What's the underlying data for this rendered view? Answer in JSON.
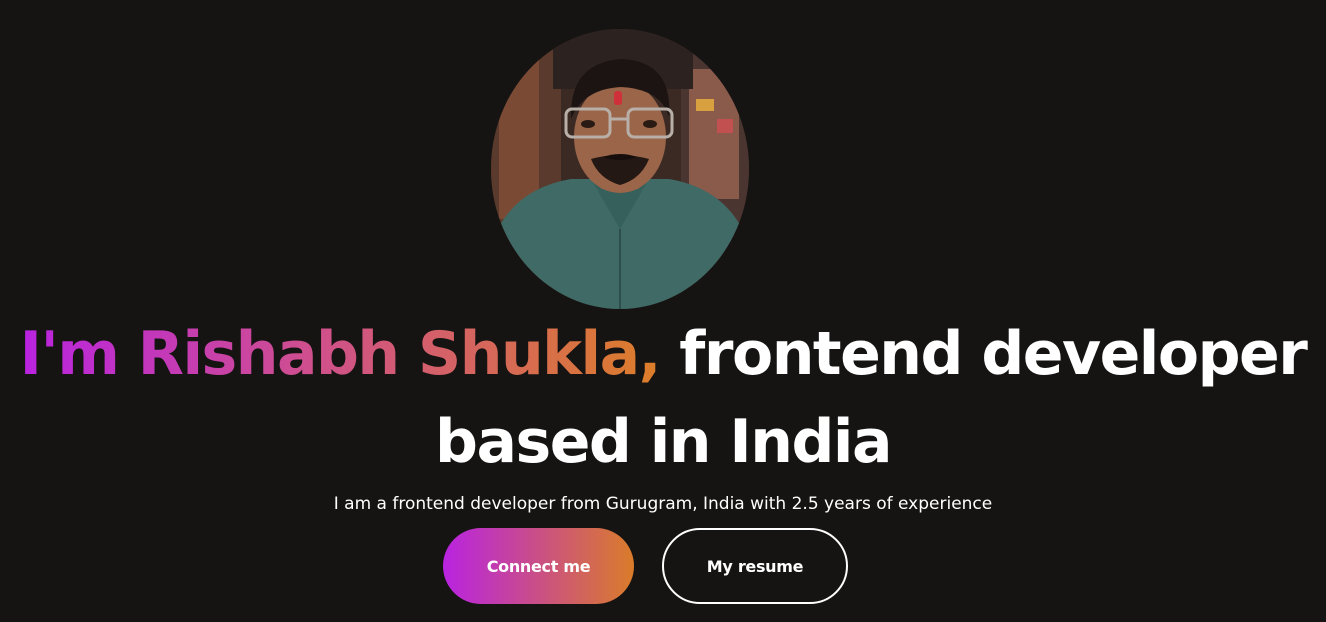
{
  "hero": {
    "avatar_alt": "Profile photo",
    "name_part": "I'm Rishabh Shukla,",
    "role_part": "frontend developer",
    "line2": "based in India",
    "tagline": "I am a frontend developer from Gurugram, India with 2.5 years of experience",
    "colors": {
      "background": "#161413",
      "gradient_start": "#b923e1",
      "gradient_end": "#dc7e29"
    }
  },
  "buttons": {
    "connect_label": "Connect me",
    "resume_label": "My resume"
  }
}
